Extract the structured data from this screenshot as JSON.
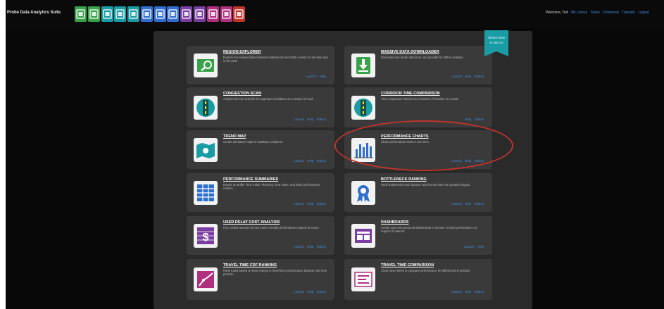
{
  "header": {
    "app_title": "Probe Data Analytics Suite",
    "tools": [
      {
        "name": "region-explorer-tool",
        "color": "#3aa24a"
      },
      {
        "name": "data-downloader-tool",
        "color": "#3aa24a"
      },
      {
        "name": "congestion-scan-tool",
        "color": "#1a9ca4"
      },
      {
        "name": "corridor-comparison-tool",
        "color": "#1a9ca4"
      },
      {
        "name": "trend-map-tool",
        "color": "#1a9ca4"
      },
      {
        "name": "performance-charts-tool",
        "color": "#2f6fd0"
      },
      {
        "name": "performance-summaries-tool",
        "color": "#2f6fd0"
      },
      {
        "name": "bottleneck-ranking-tool",
        "color": "#2f6fd0"
      },
      {
        "name": "user-delay-cost-tool",
        "color": "#7a3da0"
      },
      {
        "name": "dashboards-tool",
        "color": "#7a3da0"
      },
      {
        "name": "travel-time-cdf-tool",
        "color": "#b03080"
      },
      {
        "name": "travel-time-comparison-tool",
        "color": "#b03080"
      },
      {
        "name": "alerts-tool",
        "color": "#c0342c"
      }
    ],
    "welcome_text": "Welcome, Ted",
    "welcome_links": [
      "My Library",
      "Share",
      "Download",
      "Tutorials",
      "Logout"
    ]
  },
  "ribbon": {
    "line1": "What's New",
    "line2": "in vers.xx"
  },
  "cards": [
    {
      "title": "REGION EXPLORER",
      "desc": "Explore live relationships between bottlenecks and traffic events in real-time and in the past.",
      "links": [
        "Launch",
        "Help"
      ],
      "icon": "map-search-icon",
      "icon_color": "#3aa24a"
    },
    {
      "title": "MASSIVE DATA DOWNLOADER",
      "desc": "Download raw probe data from one provider for offline analysis.",
      "links": [
        "Launch",
        "Help",
        "Videos"
      ],
      "icon": "download-icon",
      "icon_color": "#3aa24a"
    },
    {
      "title": "CONGESTION SCAN",
      "desc": "Analyze the rise and fall of congested conditions on a stretch of road.",
      "links": [
        "Launch",
        "Help",
        "Videos"
      ],
      "icon": "congestion-scan-icon",
      "icon_color": "#1a9ca4"
    },
    {
      "title": "CORRIDOR TIME COMPARISON",
      "desc": "View congestion metrics as a function of location on a road.",
      "links": [
        "Help",
        "Videos"
      ],
      "icon": "corridor-icon",
      "icon_color": "#1a9ca4"
    },
    {
      "title": "TREND MAP",
      "desc": "Create animated maps of roadway conditions.",
      "links": [
        "Launch",
        "Help",
        "Videos"
      ],
      "icon": "trend-map-icon",
      "icon_color": "#1a9ca4"
    },
    {
      "title": "PERFORMANCE CHARTS",
      "desc": "Chart performance metrics over time.",
      "links": [
        "Launch",
        "Help",
        "Videos"
      ],
      "icon": "bar-chart-icon",
      "icon_color": "#2f6fd0"
    },
    {
      "title": "PERFORMANCE SUMMARIES",
      "desc": "Report on Buffer Time Index, Planning Time Index, and other performance metrics.",
      "links": [
        "Launch",
        "Help",
        "Videos"
      ],
      "icon": "table-icon",
      "icon_color": "#2f6fd0"
    },
    {
      "title": "BOTTLENECK RANKING",
      "desc": "Rank bottlenecks and discover which ones have the greatest impact.",
      "links": [
        "Launch",
        "Help",
        "Videos"
      ],
      "icon": "ribbon-award-icon",
      "icon_color": "#2f6fd0"
    },
    {
      "title": "USER DELAY COST ANALYSIS",
      "desc": "Put a dollar amount on how much a health performance impacts its users.",
      "links": [
        "Launch",
        "Help",
        "Videos"
      ],
      "icon": "dollar-icon",
      "icon_color": "#7a3da0"
    },
    {
      "title": "DASHBOARDS",
      "desc": "Create your own personal dashboards to monitor corridor performance on regions of interest.",
      "links": [
        "Launch",
        "Help"
      ],
      "icon": "dashboard-icon",
      "icon_color": "#7a3da0"
    },
    {
      "title": "TRAVEL TIME CDF RANKING",
      "desc": "Rank roads based on their change in travel time performance between two time periods.",
      "links": [
        "Launch",
        "Help",
        "Videos"
      ],
      "icon": "cdf-chart-icon",
      "icon_color": "#b03080"
    },
    {
      "title": "TRAVEL TIME COMPARISON",
      "desc": "Chart travel times to compare performance for different time periods.",
      "links": [
        "Launch",
        "Help",
        "Videos"
      ],
      "icon": "comparison-list-icon",
      "icon_color": "#b03080"
    }
  ]
}
